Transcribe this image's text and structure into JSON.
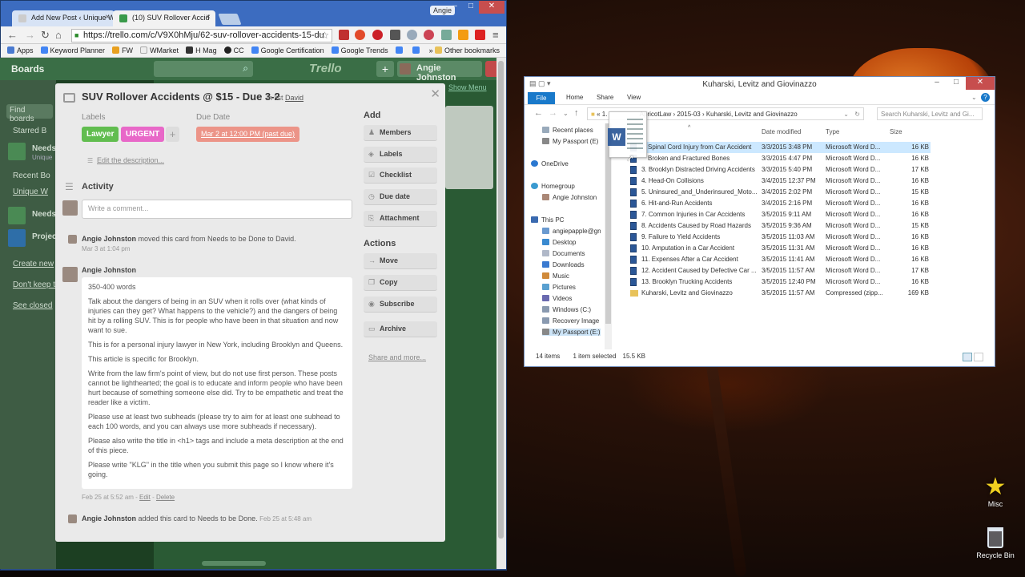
{
  "browser": {
    "tabs": [
      {
        "title": "Add New Post ‹ Unique W",
        "favicon_color": "#cccccc"
      },
      {
        "title": "(10) SUV Rollover Accid",
        "favicon_color": "#3a9a4a"
      }
    ],
    "user": "Angie",
    "url": "https://trello.com/c/V9X0hMju/62-suv-rollover-accidents-15-du",
    "bookmarks": [
      "Apps",
      "Keyword Planner",
      "FW",
      "WMarket",
      "H Mag",
      "CC",
      "Google Certification",
      "Google Trends"
    ],
    "other_bookmarks": "Other bookmarks",
    "overflow": "»"
  },
  "trello": {
    "boards_label": "Boards",
    "logo": "Trello",
    "user_name": "Angie Johnston",
    "show_menu": "Show Menu",
    "sidebar": {
      "search": "Find boards",
      "starred": "Starred B",
      "recent": "Recent Bo",
      "items": [
        "Needs",
        "Unique",
        "Unique W",
        "Needs",
        "Project"
      ],
      "links": [
        "Create new",
        "Don't keep t",
        "See closed"
      ]
    },
    "card": {
      "title": "SUV Rollover Accidents @ $15 - Due 3-2",
      "in_list_prefix": "in list",
      "list_name": "David",
      "labels_heading": "Labels",
      "labels": [
        {
          "text": "Lawyer",
          "color": "#61bd4f"
        },
        {
          "text": "URGENT",
          "color": "#e868c8"
        }
      ],
      "due_heading": "Due Date",
      "due": "Mar 2 at 12:00 PM (past due)",
      "edit_description": "Edit the description...",
      "activity_heading": "Activity",
      "comment_placeholder": "Write a comment...",
      "activity1": {
        "user": "Angie Johnston",
        "text": "moved this card from Needs to be Done to David.",
        "date": "Mar 3 at 1:04 pm"
      },
      "comment_author": "Angie Johnston",
      "comment_paragraphs": [
        "350-400 words",
        "Talk about the dangers of being in an SUV when it rolls over (what kinds of injuries can they get? What happens to the vehicle?) and the dangers of being hit by a rolling SUV. This is for people who have been in that situation and now want to sue.",
        "This is for a personal injury lawyer in New York, including Brooklyn and Queens.",
        "This article is specific for Brooklyn.",
        "Write from the law firm's point of view, but do not use first person. These posts cannot be lighthearted; the goal is to educate and inform people who have been hurt because of something someone else did. Try to be empathetic and treat the reader like a victim.",
        "Please use at least two subheads (please try to aim for at least one subhead to each 100 words, and you can always use more subheads if necessary).",
        "Please also write the title in <h1> tags and include a meta description at the end of this piece.",
        "Please write \"KLG\" in the title when you submit this page so I know where it's going."
      ],
      "comment_meta": {
        "date": "Feb 25 at 5:52 am",
        "sep1": " - ",
        "edit": "Edit",
        "sep2": " - ",
        "delete": "Delete"
      },
      "activity2": {
        "user": "Angie Johnston",
        "text": "added this card to Needs to be Done.",
        "date": "Feb 25 at 5:48 am"
      },
      "add_heading": "Add",
      "add_buttons": [
        "Members",
        "Labels",
        "Checklist",
        "Due date",
        "Attachment"
      ],
      "actions_heading": "Actions",
      "action_buttons": [
        "Move",
        "Copy",
        "Subscribe"
      ],
      "archive": "Archive",
      "share_more": "Share and more..."
    }
  },
  "explorer": {
    "title": "Kuharski, Levitz and Giovinazzo",
    "ribbon_tabs": [
      "File",
      "Home",
      "Share",
      "View"
    ],
    "path": [
      "«",
      "1.",
      "ApricotLaw",
      "2015-03",
      "Kuharski, Levitz and Giovinazzo"
    ],
    "search_placeholder": "Search Kuharski, Levitz and Gi...",
    "nav": [
      "Recent places",
      "My Passport (E)",
      "OneDrive",
      "Homegroup",
      "Angie Johnston",
      "This PC",
      "angiepapple@gn",
      "Desktop",
      "Documents",
      "Downloads",
      "Music",
      "Pictures",
      "Videos",
      "Windows (C:)",
      "Recovery Image",
      "My Passport (E:)"
    ],
    "columns": [
      "Name",
      "Date modified",
      "Type",
      "Size"
    ],
    "files": [
      {
        "name": "Spinal Cord Injury from Car Accident",
        "date": "3/3/2015 3:48 PM",
        "type": "Microsoft Word D...",
        "size": "16 KB"
      },
      {
        "name": "Broken and Fractured Bones",
        "date": "3/3/2015 4:47 PM",
        "type": "Microsoft Word D...",
        "size": "16 KB"
      },
      {
        "name": "3. Brooklyn Distracted Driving Accidents",
        "date": "3/3/2015 5:40 PM",
        "type": "Microsoft Word D...",
        "size": "17 KB"
      },
      {
        "name": "4. Head-On Collisions",
        "date": "3/4/2015 12:37 PM",
        "type": "Microsoft Word D...",
        "size": "16 KB"
      },
      {
        "name": "5. Uninsured_and_Underinsured_Moto...",
        "date": "3/4/2015 2:02 PM",
        "type": "Microsoft Word D...",
        "size": "15 KB"
      },
      {
        "name": "6. Hit-and-Run Accidents",
        "date": "3/4/2015 2:16 PM",
        "type": "Microsoft Word D...",
        "size": "16 KB"
      },
      {
        "name": "7. Common Injuries in Car Accidents",
        "date": "3/5/2015 9:11 AM",
        "type": "Microsoft Word D...",
        "size": "16 KB"
      },
      {
        "name": "8. Accidents Caused by Road Hazards",
        "date": "3/5/2015 9:36 AM",
        "type": "Microsoft Word D...",
        "size": "15 KB"
      },
      {
        "name": "9. Failure to Yield Accidents",
        "date": "3/5/2015 11:03 AM",
        "type": "Microsoft Word D...",
        "size": "16 KB"
      },
      {
        "name": "10. Amputation in a Car Accident",
        "date": "3/5/2015 11:31 AM",
        "type": "Microsoft Word D...",
        "size": "16 KB"
      },
      {
        "name": "11. Expenses After a Car Accident",
        "date": "3/5/2015 11:41 AM",
        "type": "Microsoft Word D...",
        "size": "16 KB"
      },
      {
        "name": "12. Accident Caused by Defective Car ...",
        "date": "3/5/2015 11:57 AM",
        "type": "Microsoft Word D...",
        "size": "17 KB"
      },
      {
        "name": "13. Brooklyn Trucking Accidents",
        "date": "3/5/2015 12:40 PM",
        "type": "Microsoft Word D...",
        "size": "16 KB"
      },
      {
        "name": "Kuharski, Levitz and Giovinazzo",
        "date": "3/5/2015 11:57 AM",
        "type": "Compressed (zipp...",
        "size": "169 KB"
      }
    ],
    "status_items": "14 items",
    "status_selected": "1 item selected",
    "status_size": "15.5 KB"
  },
  "desktop": {
    "icons": [
      "Misc",
      "Recycle Bin"
    ]
  }
}
